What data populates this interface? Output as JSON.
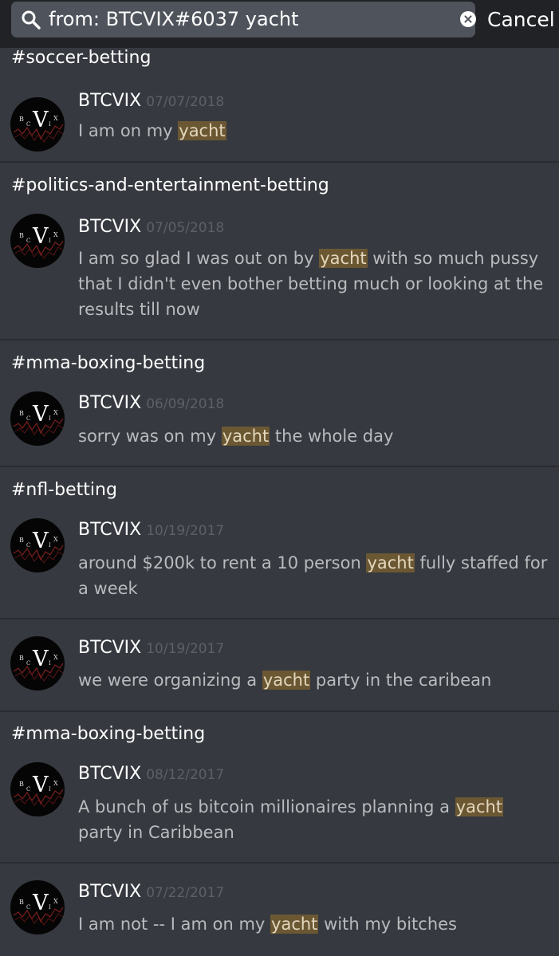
{
  "search": {
    "query": "from: BTCVIX#6037 yacht",
    "cancel_label": "Cancel"
  },
  "avatar": {
    "letters": [
      "B",
      "C",
      "V",
      "I",
      "X"
    ]
  },
  "results": [
    {
      "channel": "#soccer-betting",
      "author": "BTCVIX",
      "date": "07/07/2018",
      "pre": "I am on my ",
      "hit": "yacht",
      "post": ""
    },
    {
      "channel": "#politics-and-entertainment-betting",
      "author": "BTCVIX",
      "date": "07/05/2018",
      "pre": "I am so glad I was out on by ",
      "hit": "yacht",
      "post": " with so much pussy that I didn't even bother betting much or looking at the results till now"
    },
    {
      "channel": "#mma-boxing-betting",
      "author": "BTCVIX",
      "date": "06/09/2018",
      "pre": "sorry was on my ",
      "hit": "yacht",
      "post": " the whole day"
    },
    {
      "channel": "#nfl-betting",
      "author": "BTCVIX",
      "date": "10/19/2017",
      "pre": "around $200k to rent a 10 person ",
      "hit": "yacht",
      "post": " fully staffed for a week"
    },
    {
      "channel": "",
      "author": "BTCVIX",
      "date": "10/19/2017",
      "pre": "we were organizing a ",
      "hit": "yacht",
      "post": " party in the caribean"
    },
    {
      "channel": "#mma-boxing-betting",
      "author": "BTCVIX",
      "date": "08/12/2017",
      "pre": "A bunch of us bitcoin millionaires planning a ",
      "hit": "yacht",
      "post": " party in Caribbean"
    },
    {
      "channel": "",
      "author": "BTCVIX",
      "date": "07/22/2017",
      "pre": "I am not -- I am on my ",
      "hit": "yacht",
      "post": " with my bitches"
    }
  ]
}
